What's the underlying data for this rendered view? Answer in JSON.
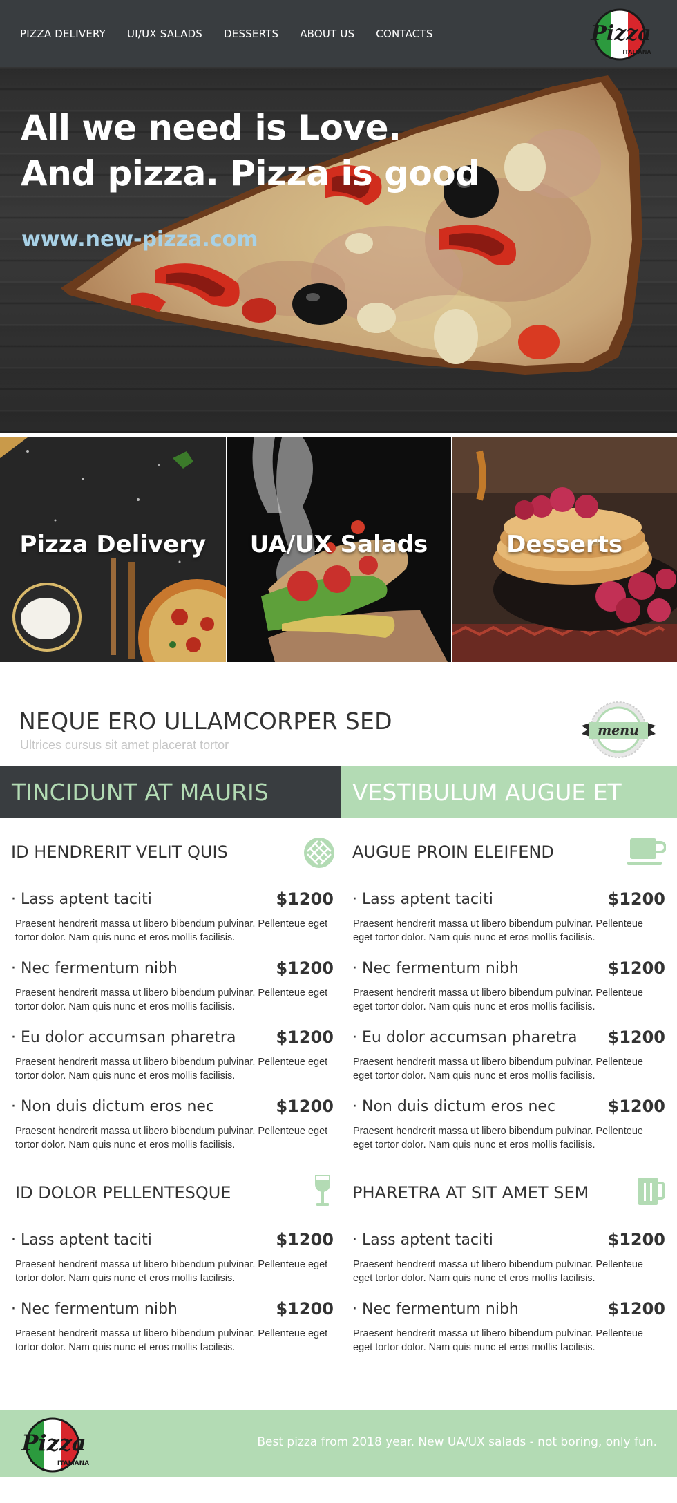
{
  "nav": {
    "links": [
      "PIZZA DELIVERY",
      "UI/UX SALADS",
      "DESSERTS",
      "ABOUT US",
      "CONTACTS"
    ]
  },
  "logo": {
    "word": "Pizza",
    "sub": "ITALIANA"
  },
  "hero": {
    "line1": "All we need is Love.",
    "line2": "And pizza. Pizza is good",
    "url": "www.new-pizza.com"
  },
  "categories": [
    "Pizza Delivery",
    "UA/UX Salads",
    "Desserts"
  ],
  "menu": {
    "title": "NEQUE ERO ULLAMCORPER SED",
    "subtitle": "Ultrices cursus sit amet placerat tortor",
    "badge": "menu"
  },
  "tabs": {
    "left": "TINCIDUNT AT MAURIS",
    "right": "VESTIBULUM AUGUE ET"
  },
  "sections": {
    "s1": {
      "title": "ID HENDRERIT VELIT QUIS",
      "icon": "waffle-icon",
      "items": [
        {
          "name": "· Lass aptent taciti",
          "price": "$1200",
          "desc": "Praesent hendrerit massa ut libero bibendum pulvinar. Pellenteue eget tortor dolor. Nam quis nunc et eros mollis facilisis."
        },
        {
          "name": "· Nec fermentum nibh",
          "price": "$1200",
          "desc": "Praesent hendrerit massa ut libero bibendum pulvinar. Pellenteue eget tortor dolor. Nam quis nunc et eros mollis facilisis."
        },
        {
          "name": "· Eu dolor accumsan pharetra",
          "price": "$1200",
          "desc": "Praesent hendrerit massa ut libero bibendum pulvinar. Pellenteue eget tortor dolor. Nam quis nunc et eros mollis facilisis."
        },
        {
          "name": "· Non duis dictum eros nec",
          "price": "$1200",
          "desc": "Praesent hendrerit massa ut libero bibendum pulvinar. Pellenteue eget tortor dolor. Nam quis nunc et eros mollis facilisis."
        }
      ]
    },
    "s2": {
      "title": "AUGUE PROIN ELEIFEND",
      "icon": "coffee-cup-icon",
      "items": [
        {
          "name": "· Lass aptent taciti",
          "price": "$1200",
          "desc": "Praesent hendrerit massa ut libero bibendum pulvinar. Pellenteue eget tortor dolor. Nam quis nunc et eros mollis facilisis."
        },
        {
          "name": "· Nec fermentum nibh",
          "price": "$1200",
          "desc": "Praesent hendrerit massa ut libero bibendum pulvinar. Pellenteue eget tortor dolor. Nam quis nunc et eros mollis facilisis."
        },
        {
          "name": "· Eu dolor accumsan pharetra",
          "price": "$1200",
          "desc": "Praesent hendrerit massa ut libero bibendum pulvinar. Pellenteue eget tortor dolor. Nam quis nunc et eros mollis facilisis."
        },
        {
          "name": "· Non duis dictum eros nec",
          "price": "$1200",
          "desc": "Praesent hendrerit massa ut libero bibendum pulvinar. Pellenteue eget tortor dolor. Nam quis nunc et eros mollis facilisis."
        }
      ]
    },
    "s3": {
      "title": "ID DOLOR PELLENTESQUE",
      "icon": "wine-glass-icon",
      "items": [
        {
          "name": "· Lass aptent taciti",
          "price": "$1200",
          "desc": "Praesent hendrerit massa ut libero bibendum pulvinar. Pellenteue eget tortor dolor. Nam quis nunc et eros mollis facilisis."
        },
        {
          "name": "· Nec fermentum nibh",
          "price": "$1200",
          "desc": "Praesent hendrerit massa ut libero bibendum pulvinar. Pellenteue eget tortor dolor. Nam quis nunc et eros mollis facilisis."
        }
      ]
    },
    "s4": {
      "title": "PHARETRA AT SIT AMET SEM",
      "icon": "beer-mug-icon",
      "items": [
        {
          "name": "· Lass aptent taciti",
          "price": "$1200",
          "desc": "Praesent hendrerit massa ut libero bibendum pulvinar. Pellenteue eget tortor dolor. Nam quis nunc et eros mollis facilisis."
        },
        {
          "name": "· Nec fermentum nibh",
          "price": "$1200",
          "desc": "Praesent hendrerit massa ut libero bibendum pulvinar. Pellenteue eget tortor dolor. Nam quis nunc et eros mollis facilisis."
        }
      ]
    }
  },
  "footer": {
    "text": "Best pizza from 2018 year. New UA/UX salads - not boring, only fun."
  },
  "colors": {
    "dark": "#393d40",
    "accent": "#b3dbb4",
    "url": "#a8d1e6"
  }
}
